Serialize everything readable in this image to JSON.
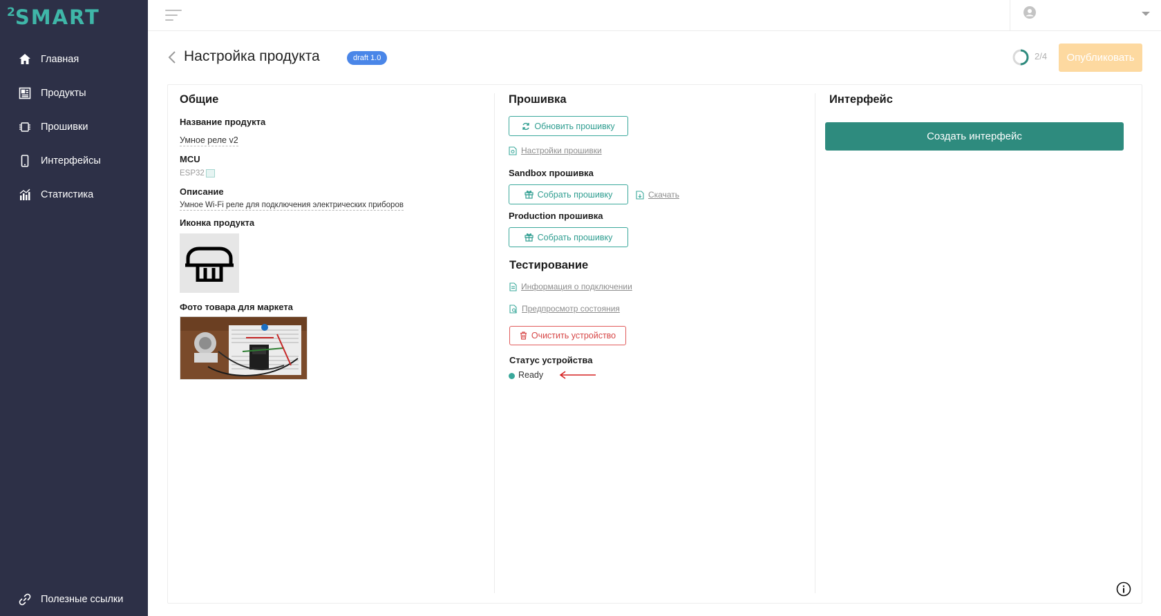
{
  "brand": {
    "logo_sup": "2",
    "logo_text": "SMART",
    "color": "#3fb6a8"
  },
  "sidebar": {
    "items": [
      {
        "label": "Главная",
        "icon": "home-icon"
      },
      {
        "label": "Продукты",
        "icon": "products-icon"
      },
      {
        "label": "Прошивки",
        "icon": "chip-icon"
      },
      {
        "label": "Интерфейсы",
        "icon": "phone-icon"
      },
      {
        "label": "Статистика",
        "icon": "stats-icon"
      }
    ],
    "bottom": {
      "label": "Полезные ссылки",
      "icon": "link-icon"
    }
  },
  "header": {
    "title": "Настройка продукта",
    "badge": "draft 1.0",
    "progress_text": "2/4",
    "progress_fraction": 0.5,
    "publish_label": "Опубликовать"
  },
  "general": {
    "title": "Общие",
    "name_label": "Название продукта",
    "name_value": "Умное реле v2",
    "mcu_label": "MCU",
    "mcu_value": "ESP32",
    "desc_label": "Описание",
    "desc_value": "Умное Wi-Fi реле для подключения электрических приборов",
    "icon_label": "Иконка продукта",
    "photo_label": "Фото товара для маркета"
  },
  "firmware": {
    "title": "Прошивка",
    "update_btn": "Обновить прошивку",
    "settings_link": "Настройки прошивки",
    "sandbox_label": "Sandbox прошивка",
    "sandbox_build_btn": "Собрать прошивку",
    "download_link": "Скачать",
    "production_label": "Production прошивка",
    "production_build_btn": "Собрать прошивку"
  },
  "testing": {
    "title": "Тестирование",
    "connection_info_link": "Информация о подключении",
    "preview_link": "Предпросмотр состояния",
    "clear_btn": "Очистить устройство",
    "status_label": "Статус устройства",
    "status_value": "Ready"
  },
  "interface": {
    "title": "Интерфейс",
    "create_btn": "Создать интерфейс"
  },
  "colors": {
    "sidebar_bg": "#2d3047",
    "accent": "#2e8b7e",
    "badge": "#4a86e8",
    "publish_disabled": "#fdd9a0",
    "danger": "#d64545",
    "arrow": "#d62020"
  }
}
